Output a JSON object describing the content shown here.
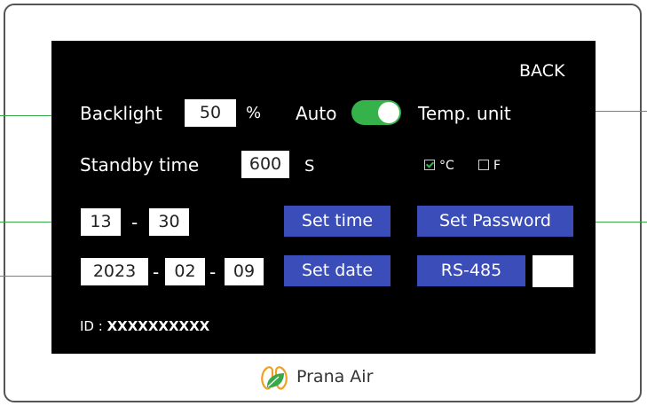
{
  "header": {
    "back_label": "BACK"
  },
  "backlight": {
    "label": "Backlight",
    "value": "50",
    "unit": "%",
    "auto_label": "Auto",
    "auto_enabled": true
  },
  "temp": {
    "label": "Temp. unit",
    "celsius_label": "°C",
    "fahrenheit_label": "F",
    "selected": "°C"
  },
  "standby": {
    "label": "Standby time",
    "value": "600",
    "unit": "S"
  },
  "time": {
    "hour": "13",
    "separator": "-",
    "minute": "30",
    "set_label": "Set time"
  },
  "date": {
    "year": "2023",
    "month": "02",
    "day": "09",
    "separator": "-",
    "set_label": "Set date"
  },
  "password": {
    "set_label": "Set Password"
  },
  "rs485": {
    "label": "RS-485",
    "value": ""
  },
  "device_id": {
    "prefix": "ID :",
    "value": "XXXXXXXXXX"
  },
  "brand": {
    "name": "Prana Air"
  },
  "colors": {
    "accent_button": "#3a4db8",
    "toggle_on": "#35b24a",
    "callout_line": "#3aa84a"
  }
}
